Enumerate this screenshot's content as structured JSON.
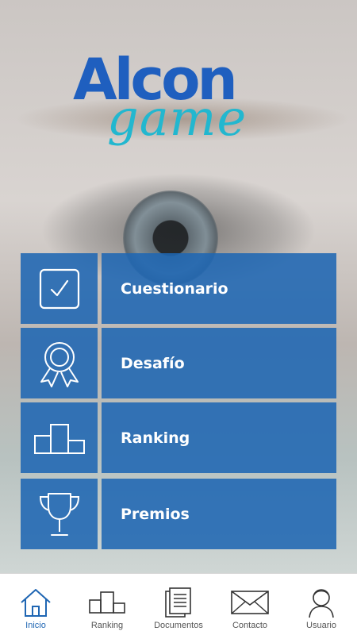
{
  "app": {
    "logo_primary": "Alcon",
    "logo_secondary": "game"
  },
  "colors": {
    "brand_blue": "#1f66b3",
    "logo_blue": "#1f5fbf",
    "logo_cyan": "#22b7cf",
    "tab_active": "#1f66b3",
    "tab_inactive": "#555555"
  },
  "menu": {
    "items": [
      {
        "label": "Cuestionario",
        "icon": "checkbox-icon"
      },
      {
        "label": "Desafío",
        "icon": "award-ribbon-icon"
      },
      {
        "label": "Ranking",
        "icon": "podium-icon"
      },
      {
        "label": "Premios",
        "icon": "trophy-icon"
      }
    ]
  },
  "tabbar": {
    "active": "Inicio",
    "items": [
      {
        "label": "Inicio",
        "icon": "home-icon"
      },
      {
        "label": "Ranking",
        "icon": "podium-icon"
      },
      {
        "label": "Documentos",
        "icon": "documents-icon"
      },
      {
        "label": "Contacto",
        "icon": "envelope-icon"
      },
      {
        "label": "Usuario",
        "icon": "user-icon"
      }
    ]
  }
}
